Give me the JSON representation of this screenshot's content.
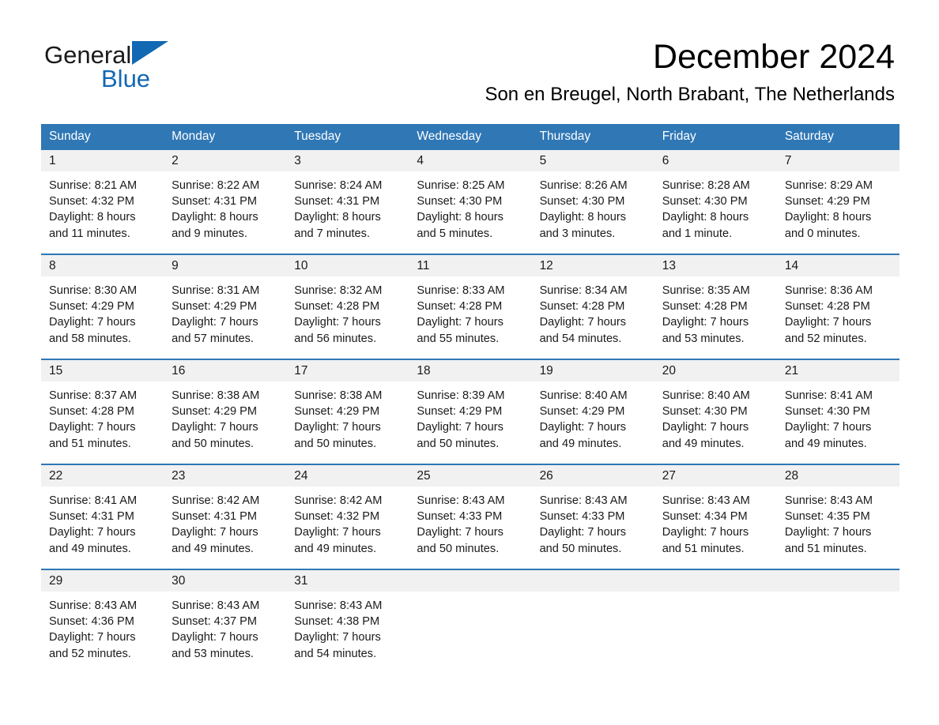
{
  "brand": {
    "name_part1": "General",
    "name_part2": "Blue",
    "triangle_color": "#1268b3",
    "text_color": "#1a1a1a"
  },
  "header": {
    "title": "December 2024",
    "subtitle": "Son en Breugel, North Brabant, The Netherlands"
  },
  "colors": {
    "header_blue": "#2f77b5",
    "day_band_gray": "#f1f1f1",
    "text": "#1a1a1a"
  },
  "weekdays": [
    "Sunday",
    "Monday",
    "Tuesday",
    "Wednesday",
    "Thursday",
    "Friday",
    "Saturday"
  ],
  "weeks": [
    [
      {
        "day": "1",
        "lines": [
          "Sunrise: 8:21 AM",
          "Sunset: 4:32 PM",
          "Daylight: 8 hours",
          "and 11 minutes."
        ]
      },
      {
        "day": "2",
        "lines": [
          "Sunrise: 8:22 AM",
          "Sunset: 4:31 PM",
          "Daylight: 8 hours",
          "and 9 minutes."
        ]
      },
      {
        "day": "3",
        "lines": [
          "Sunrise: 8:24 AM",
          "Sunset: 4:31 PM",
          "Daylight: 8 hours",
          "and 7 minutes."
        ]
      },
      {
        "day": "4",
        "lines": [
          "Sunrise: 8:25 AM",
          "Sunset: 4:30 PM",
          "Daylight: 8 hours",
          "and 5 minutes."
        ]
      },
      {
        "day": "5",
        "lines": [
          "Sunrise: 8:26 AM",
          "Sunset: 4:30 PM",
          "Daylight: 8 hours",
          "and 3 minutes."
        ]
      },
      {
        "day": "6",
        "lines": [
          "Sunrise: 8:28 AM",
          "Sunset: 4:30 PM",
          "Daylight: 8 hours",
          "and 1 minute."
        ]
      },
      {
        "day": "7",
        "lines": [
          "Sunrise: 8:29 AM",
          "Sunset: 4:29 PM",
          "Daylight: 8 hours",
          "and 0 minutes."
        ]
      }
    ],
    [
      {
        "day": "8",
        "lines": [
          "Sunrise: 8:30 AM",
          "Sunset: 4:29 PM",
          "Daylight: 7 hours",
          "and 58 minutes."
        ]
      },
      {
        "day": "9",
        "lines": [
          "Sunrise: 8:31 AM",
          "Sunset: 4:29 PM",
          "Daylight: 7 hours",
          "and 57 minutes."
        ]
      },
      {
        "day": "10",
        "lines": [
          "Sunrise: 8:32 AM",
          "Sunset: 4:28 PM",
          "Daylight: 7 hours",
          "and 56 minutes."
        ]
      },
      {
        "day": "11",
        "lines": [
          "Sunrise: 8:33 AM",
          "Sunset: 4:28 PM",
          "Daylight: 7 hours",
          "and 55 minutes."
        ]
      },
      {
        "day": "12",
        "lines": [
          "Sunrise: 8:34 AM",
          "Sunset: 4:28 PM",
          "Daylight: 7 hours",
          "and 54 minutes."
        ]
      },
      {
        "day": "13",
        "lines": [
          "Sunrise: 8:35 AM",
          "Sunset: 4:28 PM",
          "Daylight: 7 hours",
          "and 53 minutes."
        ]
      },
      {
        "day": "14",
        "lines": [
          "Sunrise: 8:36 AM",
          "Sunset: 4:28 PM",
          "Daylight: 7 hours",
          "and 52 minutes."
        ]
      }
    ],
    [
      {
        "day": "15",
        "lines": [
          "Sunrise: 8:37 AM",
          "Sunset: 4:28 PM",
          "Daylight: 7 hours",
          "and 51 minutes."
        ]
      },
      {
        "day": "16",
        "lines": [
          "Sunrise: 8:38 AM",
          "Sunset: 4:29 PM",
          "Daylight: 7 hours",
          "and 50 minutes."
        ]
      },
      {
        "day": "17",
        "lines": [
          "Sunrise: 8:38 AM",
          "Sunset: 4:29 PM",
          "Daylight: 7 hours",
          "and 50 minutes."
        ]
      },
      {
        "day": "18",
        "lines": [
          "Sunrise: 8:39 AM",
          "Sunset: 4:29 PM",
          "Daylight: 7 hours",
          "and 50 minutes."
        ]
      },
      {
        "day": "19",
        "lines": [
          "Sunrise: 8:40 AM",
          "Sunset: 4:29 PM",
          "Daylight: 7 hours",
          "and 49 minutes."
        ]
      },
      {
        "day": "20",
        "lines": [
          "Sunrise: 8:40 AM",
          "Sunset: 4:30 PM",
          "Daylight: 7 hours",
          "and 49 minutes."
        ]
      },
      {
        "day": "21",
        "lines": [
          "Sunrise: 8:41 AM",
          "Sunset: 4:30 PM",
          "Daylight: 7 hours",
          "and 49 minutes."
        ]
      }
    ],
    [
      {
        "day": "22",
        "lines": [
          "Sunrise: 8:41 AM",
          "Sunset: 4:31 PM",
          "Daylight: 7 hours",
          "and 49 minutes."
        ]
      },
      {
        "day": "23",
        "lines": [
          "Sunrise: 8:42 AM",
          "Sunset: 4:31 PM",
          "Daylight: 7 hours",
          "and 49 minutes."
        ]
      },
      {
        "day": "24",
        "lines": [
          "Sunrise: 8:42 AM",
          "Sunset: 4:32 PM",
          "Daylight: 7 hours",
          "and 49 minutes."
        ]
      },
      {
        "day": "25",
        "lines": [
          "Sunrise: 8:43 AM",
          "Sunset: 4:33 PM",
          "Daylight: 7 hours",
          "and 50 minutes."
        ]
      },
      {
        "day": "26",
        "lines": [
          "Sunrise: 8:43 AM",
          "Sunset: 4:33 PM",
          "Daylight: 7 hours",
          "and 50 minutes."
        ]
      },
      {
        "day": "27",
        "lines": [
          "Sunrise: 8:43 AM",
          "Sunset: 4:34 PM",
          "Daylight: 7 hours",
          "and 51 minutes."
        ]
      },
      {
        "day": "28",
        "lines": [
          "Sunrise: 8:43 AM",
          "Sunset: 4:35 PM",
          "Daylight: 7 hours",
          "and 51 minutes."
        ]
      }
    ],
    [
      {
        "day": "29",
        "lines": [
          "Sunrise: 8:43 AM",
          "Sunset: 4:36 PM",
          "Daylight: 7 hours",
          "and 52 minutes."
        ]
      },
      {
        "day": "30",
        "lines": [
          "Sunrise: 8:43 AM",
          "Sunset: 4:37 PM",
          "Daylight: 7 hours",
          "and 53 minutes."
        ]
      },
      {
        "day": "31",
        "lines": [
          "Sunrise: 8:43 AM",
          "Sunset: 4:38 PM",
          "Daylight: 7 hours",
          "and 54 minutes."
        ]
      },
      {
        "day": "",
        "lines": []
      },
      {
        "day": "",
        "lines": []
      },
      {
        "day": "",
        "lines": []
      },
      {
        "day": "",
        "lines": []
      }
    ]
  ]
}
